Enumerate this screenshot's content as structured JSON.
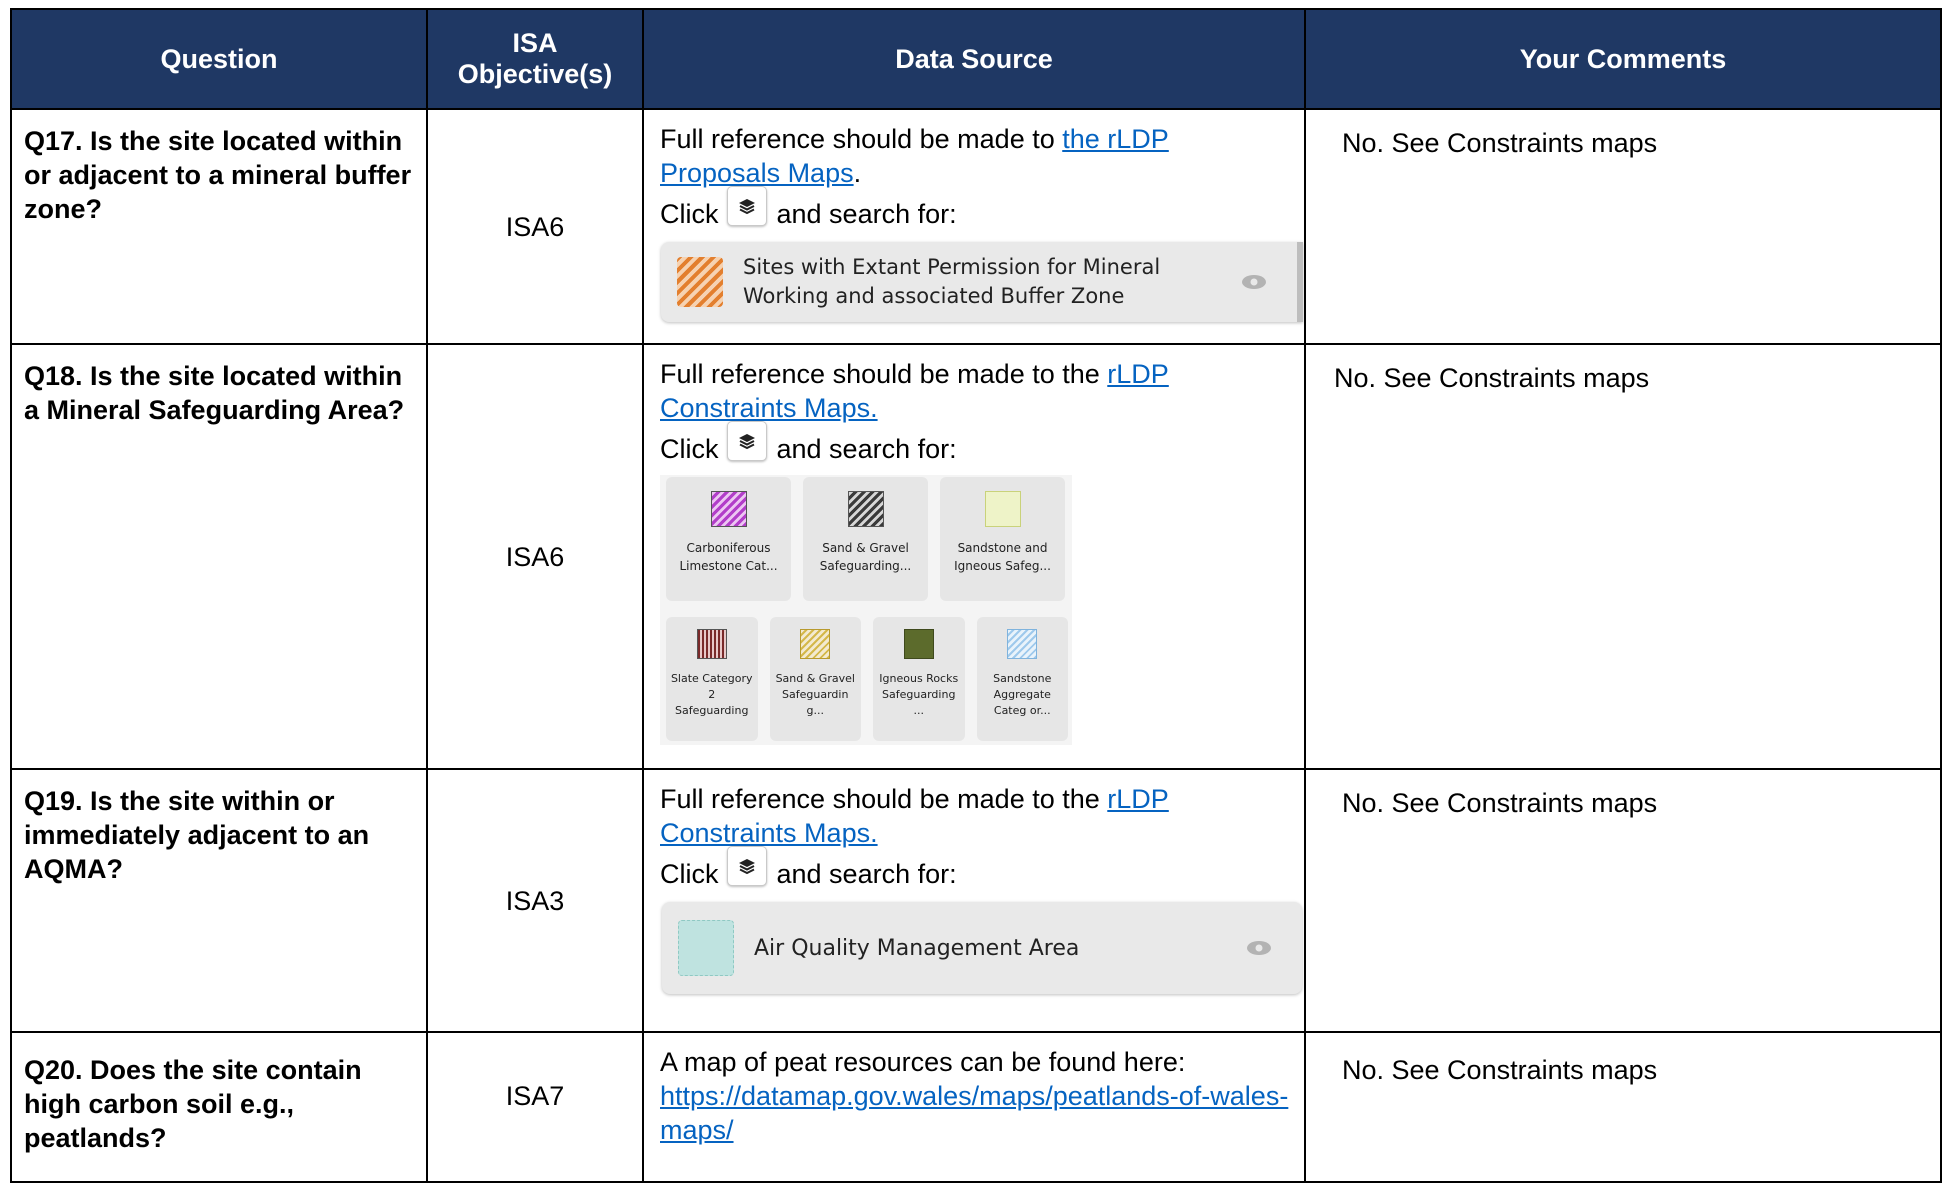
{
  "header": {
    "question": "Question",
    "isa": "ISA Objective(s)",
    "source": "Data Source",
    "comments": "Your Comments"
  },
  "common": {
    "click": "Click",
    "search": "and search for:",
    "layers_icon": "layers-icon",
    "eye_icon": "eye-icon"
  },
  "rows": [
    {
      "question": "Q17. Is the site located within or adjacent to a mineral buffer zone?",
      "isa": "ISA6",
      "source_prefix": "Full reference should be made to ",
      "link": "the rLDP Proposals Maps",
      "source_suffix": ".",
      "legend": "Sites with Extant Permission for Mineral Working and associated Buffer Zone",
      "legend_color": "#e37f2e",
      "comment": "No. See Constraints maps"
    },
    {
      "question": "Q18. Is the site located within a Mineral Safeguarding Area?",
      "isa": "ISA6",
      "source_prefix": "Full reference should be made to the ",
      "link": "rLDP Constraints Maps.",
      "tiles_top": [
        {
          "label": "Carboniferous Limestone Cat...",
          "color": "#b23ec9"
        },
        {
          "label": "Sand & Gravel Safeguarding...",
          "color": "#3a3a3a"
        },
        {
          "label": "Sandstone and Igneous Safeg...",
          "color": "#dfe8a4"
        }
      ],
      "tiles_bottom": [
        {
          "label": "Slate Category 2 Safeguarding",
          "color": "#7a2a2a"
        },
        {
          "label": "Sand & Gravel Safeguardin g...",
          "color": "#d4b84a"
        },
        {
          "label": "Igneous Rocks Safeguarding ...",
          "color": "#5c6b2c"
        },
        {
          "label": "Sandstone Aggregate Categ or...",
          "color": "#9ec9ec"
        }
      ],
      "comment": "No. See Constraints maps"
    },
    {
      "question": "Q19. Is the site within or immediately adjacent to an AQMA?",
      "isa": "ISA3",
      "source_prefix": "Full reference should be made to the ",
      "link": "rLDP Constraints Maps.",
      "legend": "Air Quality Management Area",
      "legend_color": "#bfe3e0",
      "comment": "No. See Constraints maps"
    },
    {
      "question": "Q20. Does the site contain high carbon soil e.g., peatlands?",
      "isa": "ISA7",
      "source_prefix": "A map of peat resources can be found here: ",
      "link": "https://datamap.gov.wales/maps/peatlands-of-wales-maps/",
      "comment": "No. See Constraints maps"
    }
  ]
}
